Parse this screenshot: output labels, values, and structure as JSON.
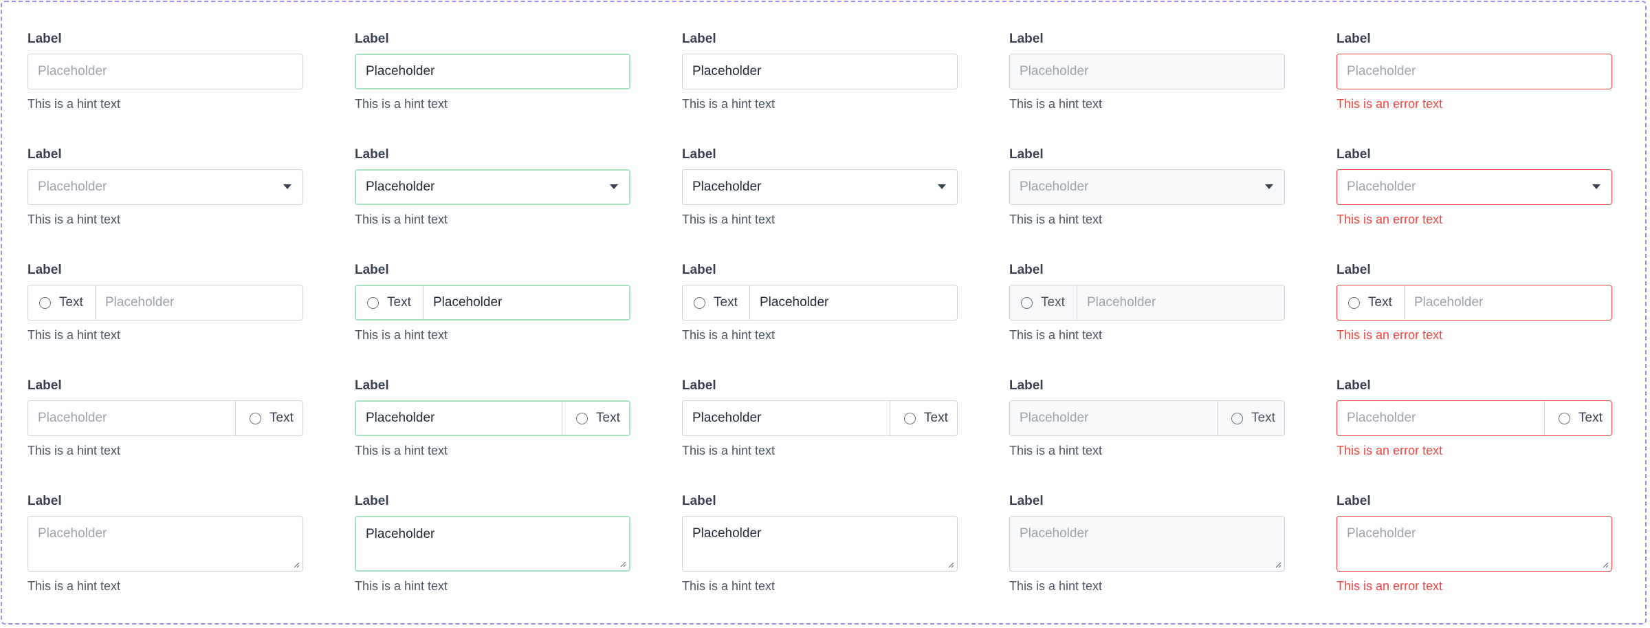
{
  "label": "Label",
  "placeholder": "Placeholder",
  "hint": "This is a hint text",
  "error": "This is an error text",
  "addon_text": "Text",
  "states": [
    "default",
    "focus",
    "filled",
    "disabled",
    "error"
  ],
  "variants": [
    "text-input",
    "select",
    "leading-addon",
    "trailing-addon",
    "textarea"
  ],
  "colors": {
    "border": "#d1d5db",
    "focus_border": "#a7e3c4",
    "error": "#ef4444",
    "disabled_bg": "#f7f8fa",
    "frame_dash": "#9b8cf5"
  }
}
